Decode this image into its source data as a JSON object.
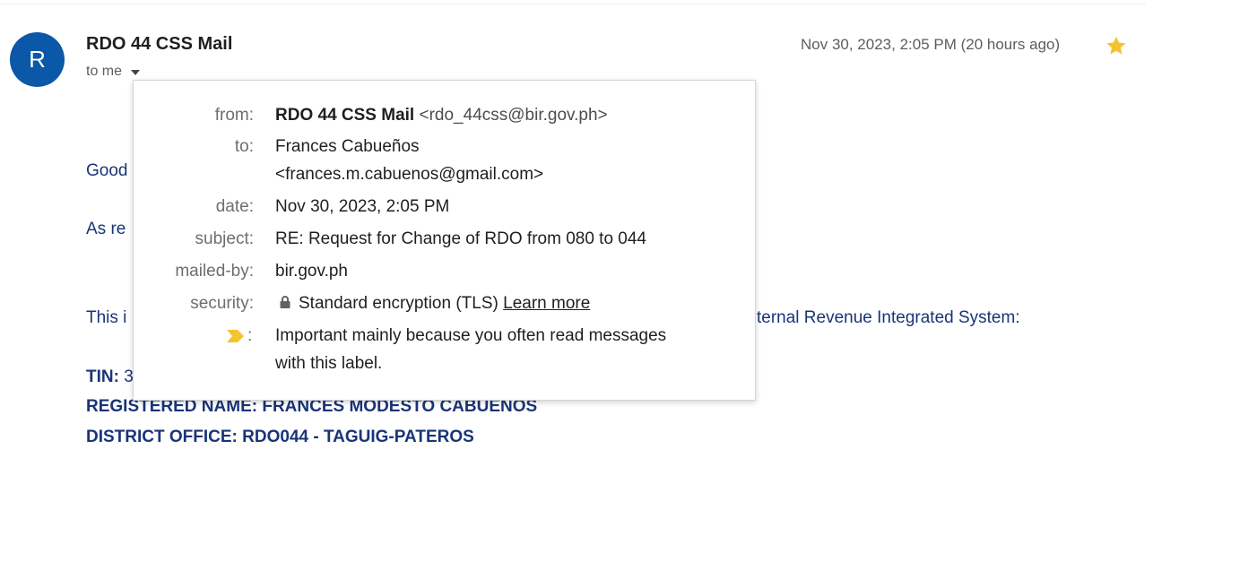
{
  "header": {
    "avatar_letter": "R",
    "sender_name": "RDO 44 CSS Mail",
    "recipient": "to me",
    "timestamp": "Nov 30, 2023, 2:05 PM (20 hours ago)",
    "star_color": "#f4c430",
    "avatar_color": "#0b57a8"
  },
  "body": {
    "greeting": "Good",
    "line2": "As re",
    "line3_start": "This i",
    "line3_end": "ternal Revenue Integrated System:",
    "tin_label": "TIN: ",
    "tin_partial": "3",
    "registered_name": "REGISTERED NAME: FRANCES MODESTO CABUENOS",
    "district_office": "DISTRICT OFFICE: RDO044 - TAGUIG-PATEROS",
    "text_color": "#1a3478"
  },
  "details_popup": {
    "from_label": "from:",
    "from_name": "RDO 44 CSS Mail",
    "from_email": "<rdo_44css@bir.gov.ph>",
    "to_label": "to:",
    "to_name": "Frances Cabueños",
    "to_email": "<frances.m.cabuenos@gmail.com>",
    "date_label": "date:",
    "date_value": "Nov 30, 2023, 2:05 PM",
    "subject_label": "subject:",
    "subject_value": "RE: Request for Change of RDO from 080 to 044",
    "mailed_by_label": "mailed-by:",
    "mailed_by_value": "bir.gov.ph",
    "security_label": "security:",
    "security_value": "Standard encryption (TLS)",
    "security_link": "Learn more",
    "importance_colon": ":",
    "importance_line1": "Important mainly because you often read messages",
    "importance_line2": "with this label.",
    "importance_color": "#f4c430"
  }
}
